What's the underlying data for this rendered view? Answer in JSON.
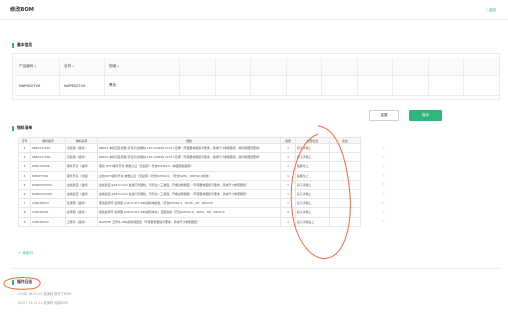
{
  "header": {
    "title": "修改BOM",
    "back_label": "〈 返回"
  },
  "basic_info": {
    "section_title": "基本信息",
    "columns": [
      "产品编码",
      "名称",
      "规格"
    ],
    "values": [
      "NAP6027VX",
      "NAP6027VX",
      "黑色"
    ],
    "reset_label": "重置",
    "save_label": "保存"
  },
  "material_list": {
    "section_title": "物料清单",
    "columns": [
      "序号",
      "物料编号",
      "物料名称",
      "规格",
      "用量",
      "使用位置",
      "备注"
    ],
    "rows": [
      [
        "1",
        "8665217001",
        "包装箱（插件）",
        "880X1 本机包装纸箱 带包平台规格1130.2x6990.2x75.5瓦楞（环保要求跟随平要求，具体尺寸参照图纸，按印刷图纸要求）",
        "1",
        "纸子手箱上",
        ""
      ],
      [
        "2",
        "8665217002",
        "包装箱（插件）",
        "880X1 本机包装纸箱 带包平台规格1130.2x6990.2x75.5瓦楞（环保要求跟随平要求，具体尺寸参照图纸，按印刷图纸要求）",
        "1",
        "纸子手箱上",
        ""
      ],
      [
        "3",
        "8981.06006",
        "撕条开关（插件）",
        "黑色 KCF3撕条开关 参数认证（无起卸）符合ROHS2.0（单面刷颜面转）",
        "1",
        "贴撕条上",
        ""
      ],
      [
        "4",
        "8981F7002",
        "撕条开关（北极）",
        "白色KCF3撕条开关 参数认证（无起卸）符合ROHS2.0，（符合PAHS、ROHS2.0标准）",
        "1",
        "贴撕条上",
        ""
      ],
      [
        "5",
        "P0060557001",
        "金属扳钮（插件）",
        "金属扳钮 φ28.5×412 金属闪光颗粒，带局边（三角面，开槽边两侧面）（环保要求跟随平要求，具体尺寸参照图纸）",
        "1",
        "接子手箱上",
        ""
      ],
      [
        "6",
        "P0060557004",
        "金属扳钮（插件）",
        "金属扳钮 φ28.5×412 金属闪光颗粒，带局边（三角面，开槽边两侧面）（环保要求跟随平要求，具体尺寸参照图纸）",
        "1",
        "接子手箱上",
        ""
      ],
      [
        "7",
        "C08136013",
        "装饰圈（插件）",
        "黑色装饰环 装饰圈 φ36.5x4Y3 ABS颜料电镀色（符合ROHS2.0、PAHS、RP、REACH）",
        "1",
        "接子手箱上",
        ""
      ],
      [
        "8",
        "C08136001",
        "装饰圈（插件）",
        "银色装饰环 装饰圈 φ36.5x4Y3 ABS颜料本色，银镀色格（符合ROHS2.0、PAHS、RP、REACH）",
        "2",
        "接子手箱上",
        ""
      ],
      [
        "9",
        "C08136020",
        "云饰条（插件）",
        "NAP6/5F 云饰条 ABS颜料纯银色（环保要求跟随平要求，具体尺寸参照图纸）",
        "1",
        "接子手箱盖上",
        ""
      ]
    ],
    "delete_icon": "trash-icon",
    "add_row_label": "+ 添加行"
  },
  "operation_log": {
    "section_title": "操作日志",
    "entries": [
      "03/08 16:51:51 路演林  修改了BOM",
      "02/07 10:11:11 路演林  创建BOM"
    ]
  },
  "colors": {
    "accent": "#2fb67c",
    "annotation": "#f06a3c"
  }
}
